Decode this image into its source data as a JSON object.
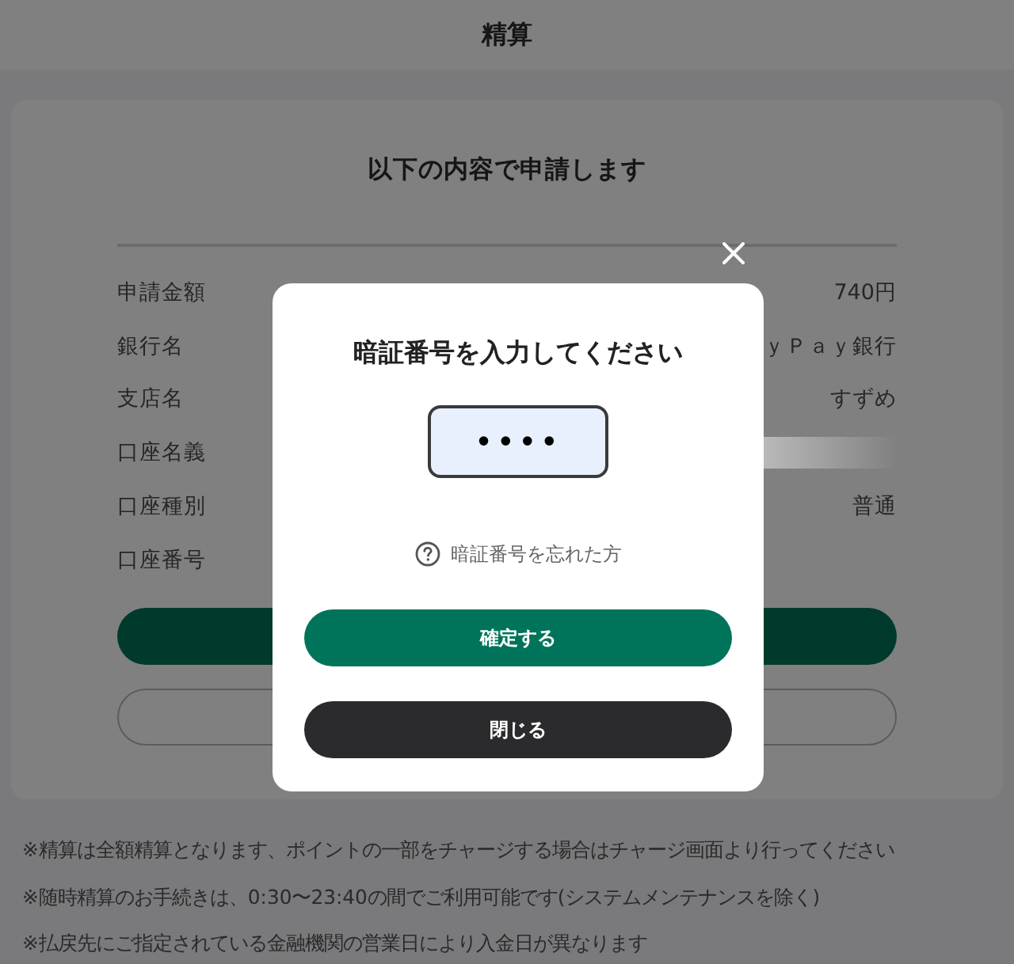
{
  "header": {
    "title": "精算"
  },
  "summary": {
    "heading": "以下の内容で申請します",
    "rows": [
      {
        "label": "申請金額",
        "kind": "text",
        "value": "740円"
      },
      {
        "label": "銀行名",
        "kind": "text",
        "value": "ｙＰａｙ銀行"
      },
      {
        "label": "支店名",
        "kind": "text",
        "value": "すずめ"
      },
      {
        "label": "口座名義",
        "kind": "redacted"
      },
      {
        "label": "口座種別",
        "kind": "text",
        "value": "普通"
      },
      {
        "label": "口座番号",
        "kind": "empty"
      }
    ],
    "actions": [
      {
        "kind": "filled"
      },
      {
        "kind": "outlined"
      }
    ]
  },
  "notes": [
    "※精算は全額精算となります、ポイントの一部をチャージする場合はチャージ画面より行ってください",
    "※随時精算のお手続きは、0:30〜23:40の間でご利用可能です(システムメンテナンスを除く)",
    "※払戻先にご指定されている金融機関の営業日により入金日が異なります"
  ],
  "pin_dialog": {
    "title": "暗証番号を入力してください",
    "pin_field": {
      "value": "••••"
    },
    "forgot_link": "暗証番号を忘れた方",
    "buttons": [
      {
        "label": "確定する",
        "kind": "primary"
      },
      {
        "label": "閉じる",
        "kind": "secondary"
      }
    ]
  }
}
